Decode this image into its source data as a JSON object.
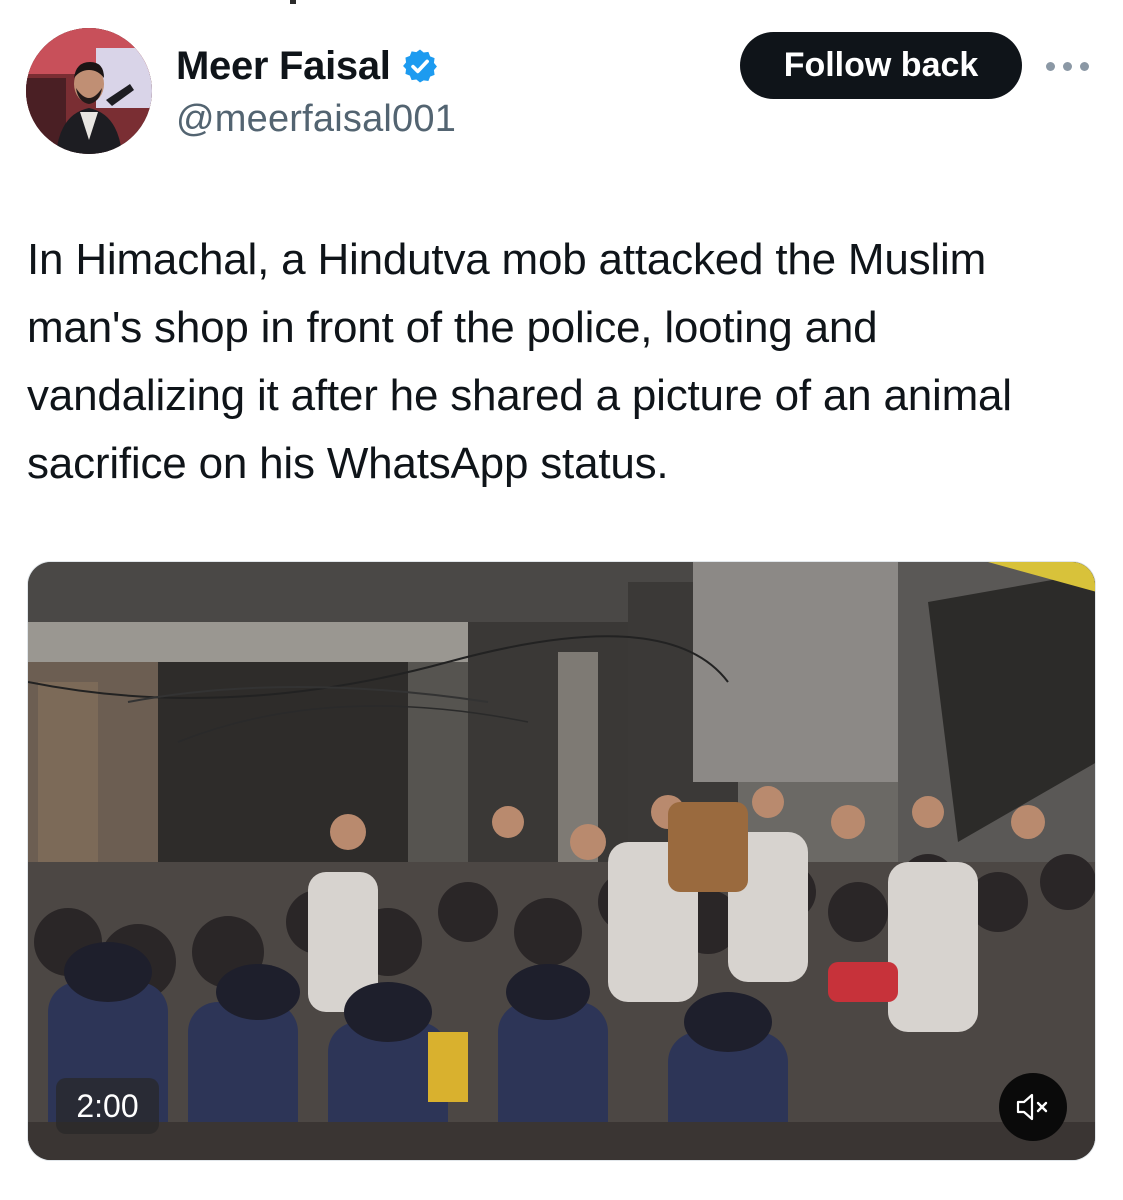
{
  "author": {
    "display_name": "Meer Faisal",
    "handle": "@meerfaisal001",
    "verified": true,
    "avatar_icon": "profile-photo"
  },
  "actions": {
    "follow_label": "Follow back",
    "more_icon": "more-horizontal-icon"
  },
  "tweet": {
    "text": "In Himachal, a Hindutva mob attacked the Muslim man's shop in front of the police, looting and vandalizing it after he shared a picture of an animal sacrifice on his WhatsApp status."
  },
  "video": {
    "duration": "2:00",
    "muted": true,
    "mute_icon": "speaker-muted-icon"
  },
  "colors": {
    "text_primary": "#0f1419",
    "text_secondary": "#536471",
    "verified_blue": "#1d9bf0",
    "button_bg": "#0f1419",
    "button_text": "#ffffff"
  }
}
